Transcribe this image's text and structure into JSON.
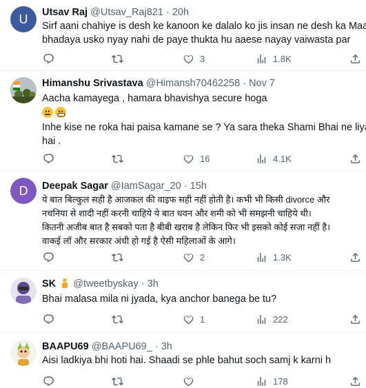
{
  "tweets": [
    {
      "name": "Utsav Raj",
      "handle": "@Utsav_Raj821",
      "sep": "·",
      "time": "20h",
      "avatar_letter": "U",
      "avatar_color": "#3b5b9a",
      "lines": [
        "Sirf aani chahiye is desh ke kanoon ke dalalo ko jis insan ne desh ka Maan",
        "bhadaya usko nyay nahi de paye thukta hu aaese nayay vaiwasta par"
      ],
      "replies": "",
      "retweets": "",
      "likes": "3",
      "views": "1.8K"
    },
    {
      "name": "Himanshu Srivastava",
      "handle": "@Himansh70462258",
      "sep": "·",
      "time": "Nov 7",
      "lines": [
        "Aacha kamayega , hamara bhavishya secure hoga",
        "",
        "Inhe kise ne roka hai paisa kamane se ? Ya sara theka Shami Bhai ne liya",
        "hai ."
      ],
      "replies": "",
      "retweets": "",
      "likes": "16",
      "views": "4.1K"
    },
    {
      "name": "Deepak Sagar",
      "handle": "@IamSagar_20",
      "sep": "·",
      "time": "15h",
      "avatar_letter": "D",
      "avatar_color": "#7e57c2",
      "lines": [
        "ये बात बिल्कुल सही है आजकल की वाइफ सही नहीं होती है। कभी भी किसी divorce और",
        "नचनिया से शादी नहीं करनी चाहिये ये बात धवन और शमी को भी समझनी चाहिये थी।",
        "कितनी अजीब बात है सबको पता है बीबी खराब है लेकिन फिर भी इसको कोई सजा नहीं है।",
        "वाकई लॉ और सरकार अंधी हो गई है ऐसी महिलाओं के आगे।"
      ],
      "replies": "",
      "retweets": "",
      "likes": "2",
      "views": "1.3K"
    },
    {
      "name": "SK",
      "handle": "@tweetbyskay",
      "sep": "·",
      "time": "3h",
      "lines": [
        "Bhai malasa mila ni jyada, kya anchor banega be tu?"
      ],
      "replies": "",
      "retweets": "",
      "likes": "1",
      "views": "222"
    },
    {
      "name": "BAAPU69",
      "handle": "@BAAPU69_",
      "sep": "·",
      "time": "3h",
      "lines": [
        "Aisi ladkiya bhi hoti hai. Shaadi se phle bahut soch samj k karni h"
      ],
      "replies": "",
      "retweets": "",
      "likes": "",
      "views": "178"
    }
  ],
  "icons": {
    "reply": "reply-icon",
    "retweet": "retweet-icon",
    "like": "like-icon",
    "views": "views-icon",
    "share": "share-icon"
  },
  "colors": {
    "text": "#0f1419",
    "muted": "#536471",
    "divider": "#eff3f4"
  }
}
